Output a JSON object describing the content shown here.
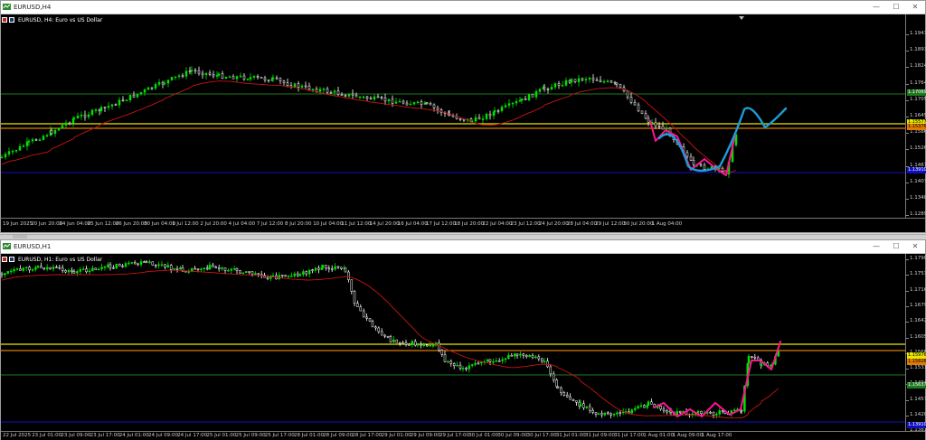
{
  "windows": [
    {
      "title": "EURUSD,H4",
      "symbol_label": "EURUSD, H4:  Euro vs US Dollar",
      "price_ticks": [
        "1.19430",
        "1.18930",
        "1.18240",
        "1.17640",
        "1.17050",
        "1.16450",
        "1.15860",
        "1.15260",
        "1.14670",
        "1.14070",
        "1.13480",
        "1.12890"
      ],
      "price_tags": [
        {
          "text": "1.17069",
          "color": "#1f7a1f",
          "fg": "#ffffff"
        },
        {
          "text": "1.15577",
          "color": "#e6e600",
          "fg": "#000000"
        },
        {
          "text": "1.15376",
          "color": "#e07b00",
          "fg": "#000000"
        },
        {
          "text": "1.13910",
          "color": "#1010c0",
          "fg": "#ffffff"
        }
      ],
      "time_labels": [
        "19 Jun 2025",
        "20 Jun 20:00",
        "24 Jun 04:00",
        "25 Jun 12:00",
        "26 Jun 20:00",
        "30 Jun 04:00",
        "1 Jul 12:00",
        "2 Jul 20:00",
        "4 Jul 04:00",
        "7 Jul 12:00",
        "8 Jul 20:00",
        "10 Jul 04:00",
        "11 Jul 12:00",
        "14 Jul 20:00",
        "16 Jul 04:00",
        "17 Jul 12:00",
        "18 Jul 20:00",
        "22 Jul 04:00",
        "23 Jul 12:00",
        "24 Jul 20:00",
        "28 Jul 04:00",
        "29 Jul 12:00",
        "30 Jul 20:00",
        "1 Aug 04:00"
      ]
    },
    {
      "title": "EURUSD,H1",
      "symbol_label": "EURUSD, H1:  Euro vs US Dollar",
      "price_ticks": [
        "1.17900",
        "1.17530",
        "1.17160",
        "1.16790",
        "1.16420",
        "1.16050",
        "1.15680",
        "1.15310",
        "1.14940",
        "1.14570",
        "1.14200",
        "1.13830"
      ],
      "price_tags": [
        {
          "text": "1.15976",
          "color": "#e6e600",
          "fg": "#000000"
        },
        {
          "text": "1.15826",
          "color": "#e07b00",
          "fg": "#000000"
        },
        {
          "text": "1.15637",
          "color": "#1f7a1f",
          "fg": "#ffffff"
        },
        {
          "text": "1.13910",
          "color": "#1010c0",
          "fg": "#ffffff"
        }
      ],
      "time_labels": [
        "22 Jul 2025",
        "23 Jul 01:00",
        "23 Jul 09:00",
        "23 Jul 17:00",
        "24 Jul 01:00",
        "24 Jul 09:00",
        "24 Jul 17:00",
        "25 Jul 01:00",
        "25 Jul 09:00",
        "25 Jul 17:00",
        "28 Jul 01:00",
        "28 Jul 09:00",
        "28 Jul 17:00",
        "29 Jul 01:00",
        "29 Jul 09:00",
        "29 Jul 17:00",
        "30 Jul 01:00",
        "30 Jul 09:00",
        "30 Jul 17:00",
        "31 Jul 01:00",
        "31 Jul 09:00",
        "31 Jul 17:00",
        "1 Aug 01:00",
        "1 Aug 09:00",
        "1 Aug 17:00"
      ]
    }
  ],
  "window_buttons": {
    "minimize": "—",
    "maximize": "☐",
    "close": "✕"
  },
  "colors": {
    "bull_candle": "#00e000",
    "bear_candle": "#ffffff",
    "moving_average": "#c81414",
    "pink_line": "#ff1493",
    "blue_line": "#1e9bd7",
    "support_line": "#1010c0",
    "yellow_line": "#e6e600",
    "orange_line": "#e07b00",
    "green_line": "#1f7a1f"
  }
}
